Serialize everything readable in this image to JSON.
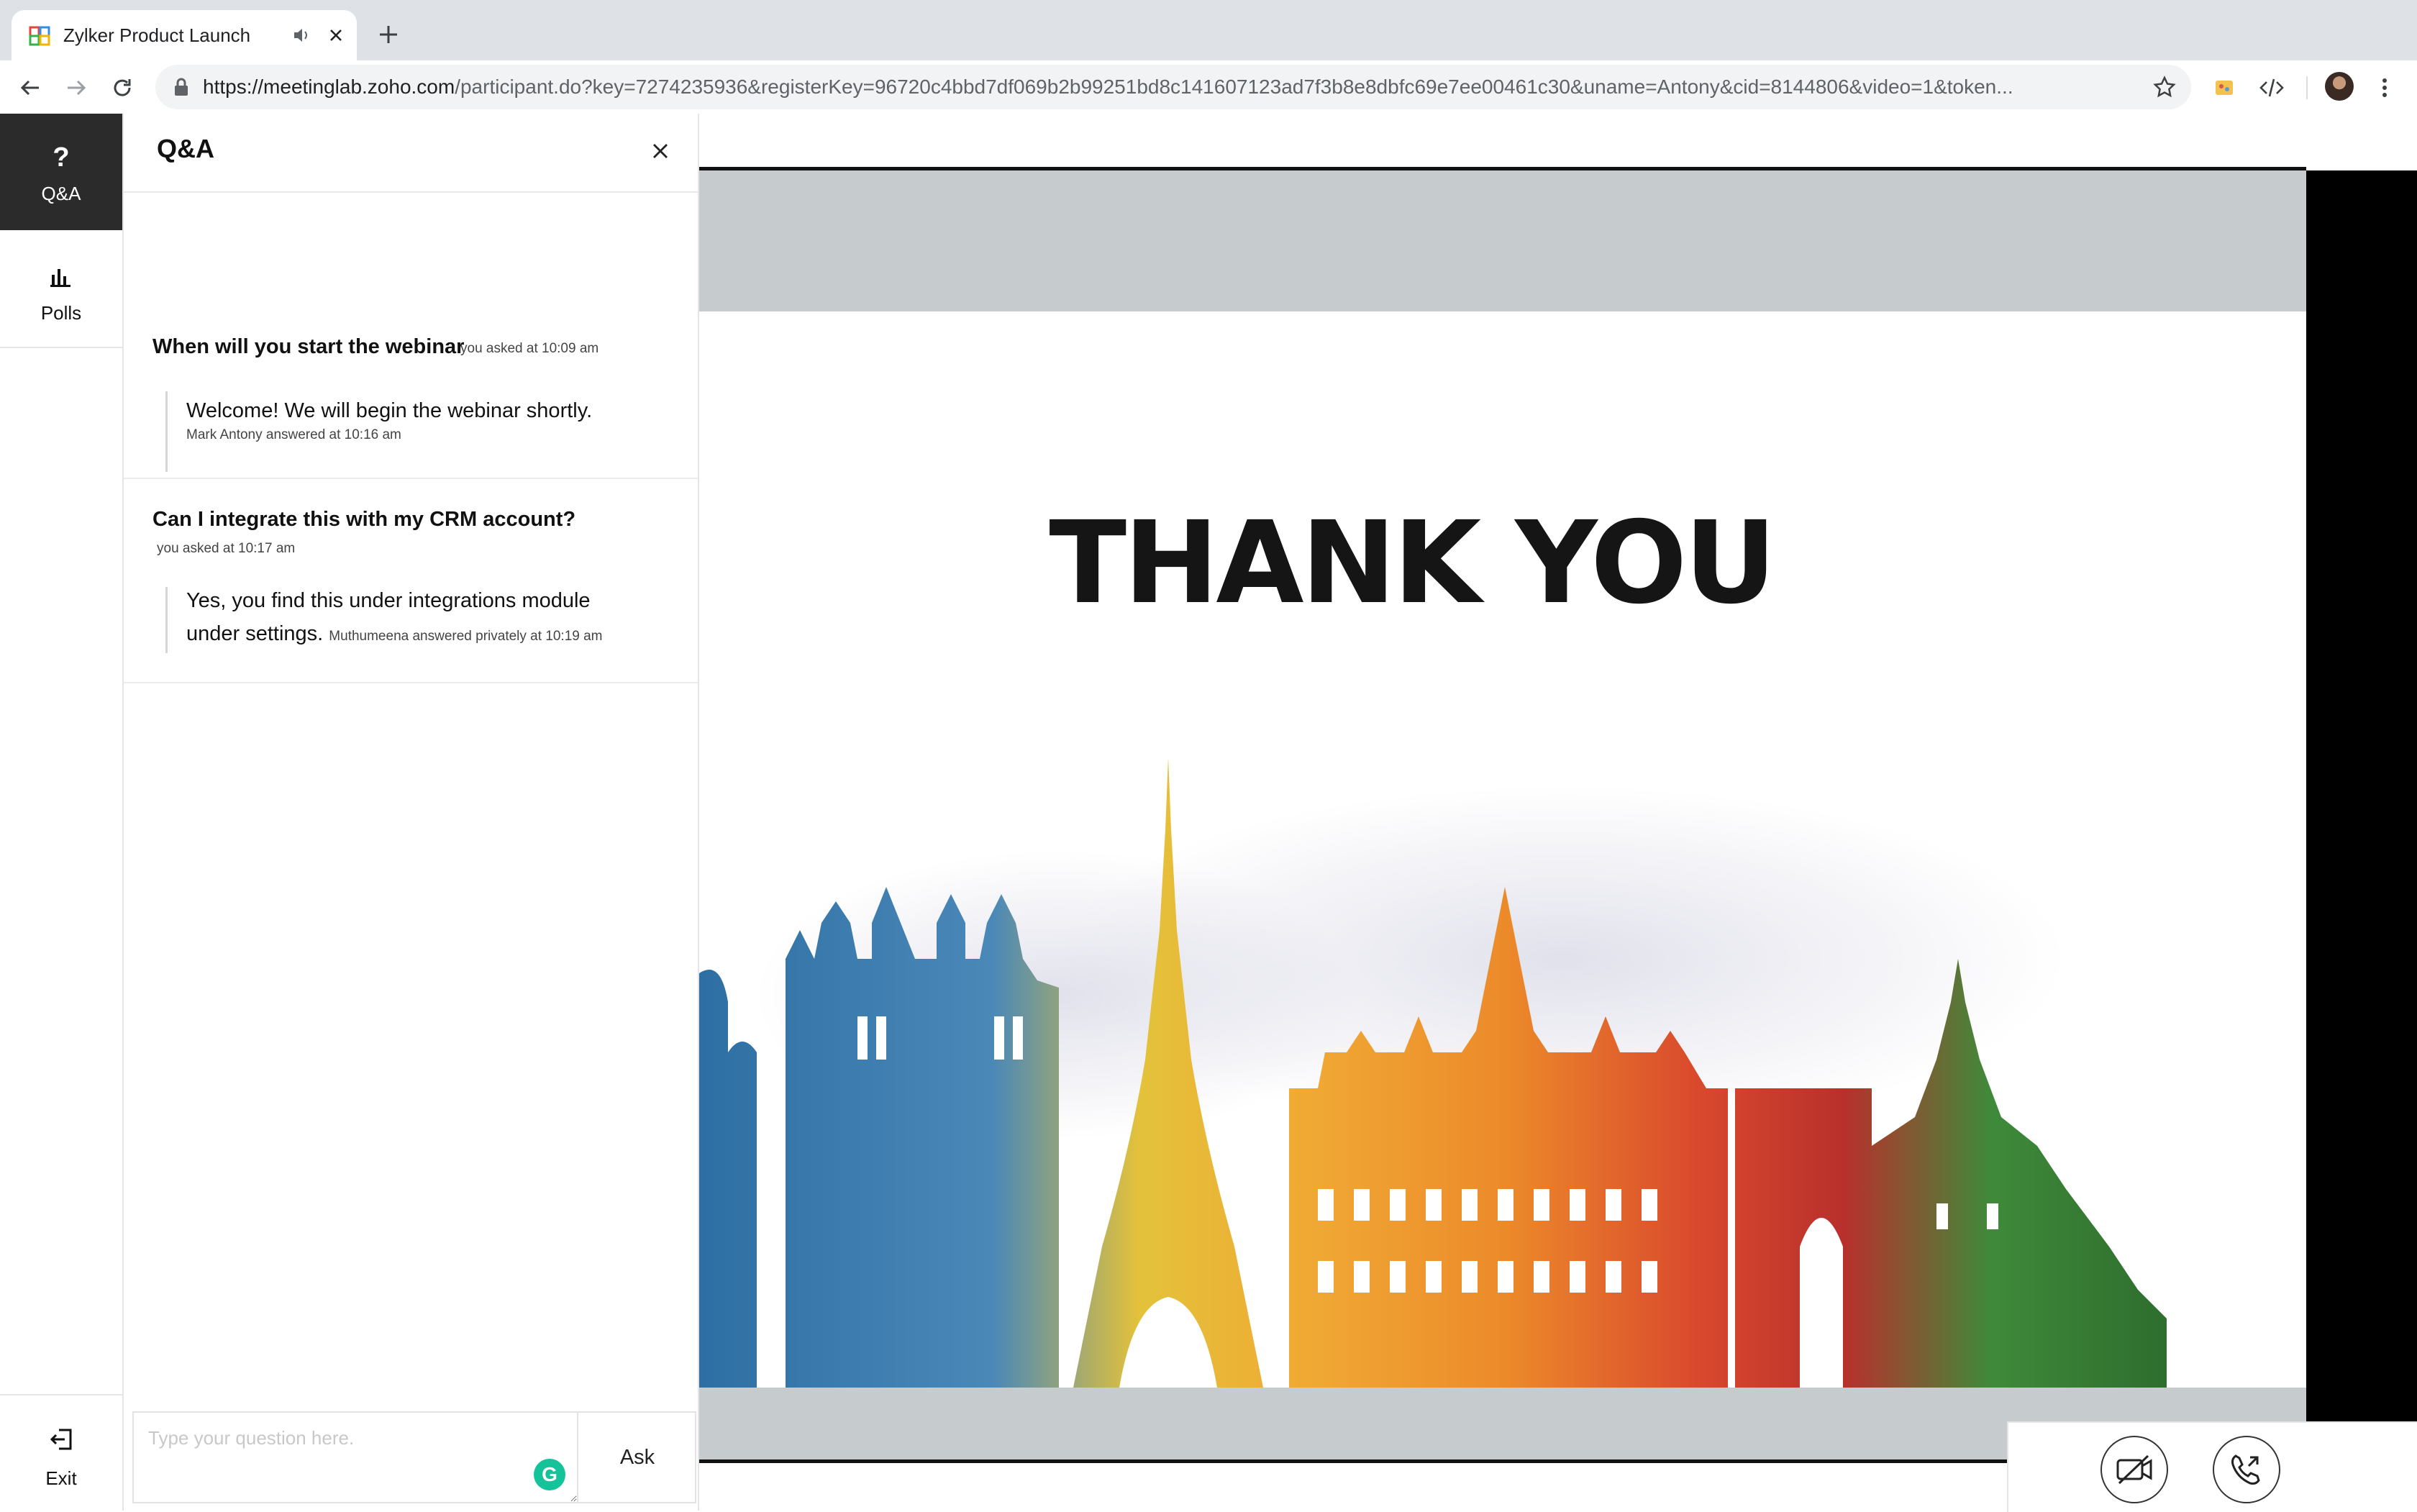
{
  "browser": {
    "tab_title": "Zylker Product Launch",
    "new_tab": "+",
    "url_host": "https://meetinglab.zoho.com",
    "url_rest": "/participant.do?key=7274235936&registerKey=96720c4bbd7df069b2b99251bd8c141607123ad7f3b8e8dbfc69e7ee00461c30&uname=Antony&cid=8144806&video=1&token..."
  },
  "sidebar": {
    "items": [
      {
        "glyph": "?",
        "label": "Q&A",
        "icon": "question-icon",
        "active": true
      },
      {
        "label": "Polls",
        "icon": "bar-chart-icon",
        "active": false
      }
    ],
    "exit_label": "Exit"
  },
  "qa": {
    "title": "Q&A",
    "questions": [
      {
        "text": "When will you start the webinar",
        "meta": "you asked at 10:09 am",
        "answer": "Welcome! We will begin the webinar shortly.",
        "answer_meta": "Mark Antony  answered at 10:16 am"
      },
      {
        "text": "Can I integrate this with my CRM account?",
        "meta": "you asked at 10:17 am",
        "answer": "Yes, you find this under integrations module under settings.",
        "answer_meta": "Muthumeena answered privately at 10:19 am"
      }
    ],
    "input_placeholder": "Type your question here.",
    "ask_label": "Ask",
    "grammarly_glyph": "G"
  },
  "slide": {
    "heading": "THANK YOU"
  },
  "colors": {
    "active_nav": "#2b2b2b",
    "slide_band": "#c6cbce",
    "grammarly": "#15c39a"
  }
}
